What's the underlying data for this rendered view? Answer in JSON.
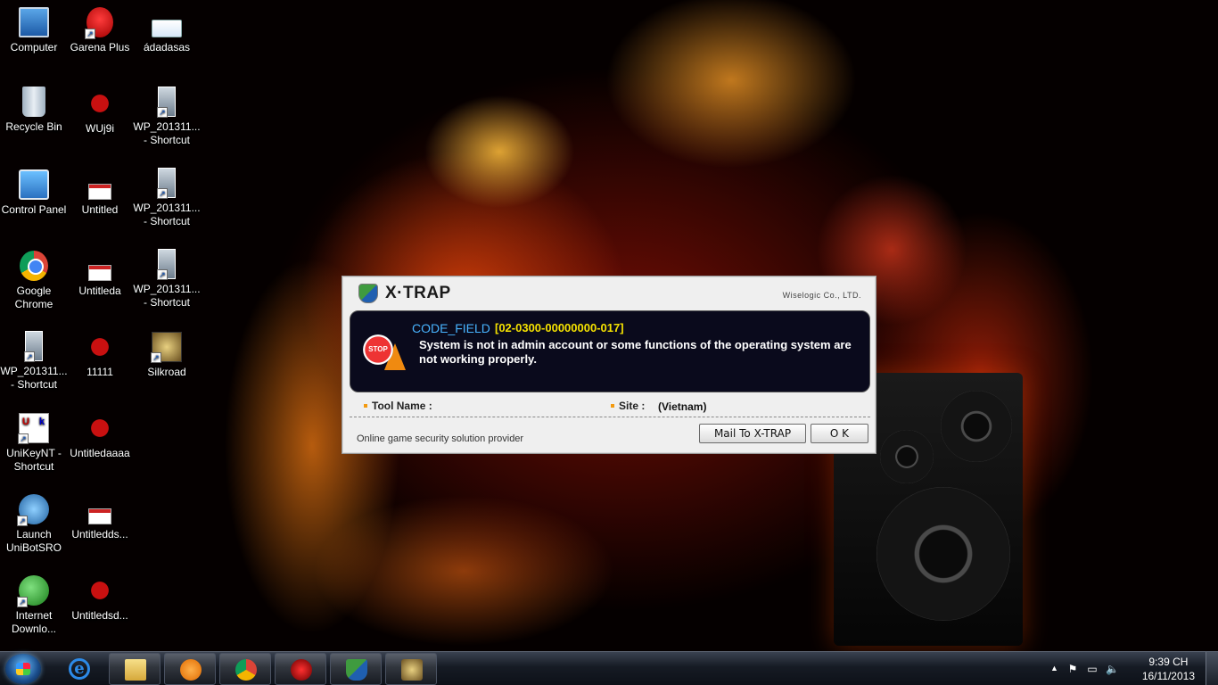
{
  "desktop": {
    "icons": [
      {
        "label": "Computer",
        "icon": "computer-icon"
      },
      {
        "label": "Garena Plus",
        "icon": "garena-icon"
      },
      {
        "label": "ádadasas",
        "icon": "document-icon"
      },
      {
        "label": "Recycle Bin",
        "icon": "recycle-bin-icon"
      },
      {
        "label": "WUj9i",
        "icon": "bug-icon"
      },
      {
        "label": "WP_201311... - Shortcut",
        "icon": "photo-icon"
      },
      {
        "label": "Control Panel",
        "icon": "control-panel-icon"
      },
      {
        "label": "Untitled",
        "icon": "paper-icon"
      },
      {
        "label": "WP_201311... - Shortcut",
        "icon": "photo-icon"
      },
      {
        "label": "Google Chrome",
        "icon": "chrome-icon"
      },
      {
        "label": "Untitleda",
        "icon": "paper-icon"
      },
      {
        "label": "WP_201311... - Shortcut",
        "icon": "photo-icon"
      },
      {
        "label": "WP_201311... - Shortcut",
        "icon": "photo-icon"
      },
      {
        "label": "11111",
        "icon": "bug-icon"
      },
      {
        "label": "Silkroad",
        "icon": "silkroad-icon"
      },
      {
        "label": "UniKeyNT - Shortcut",
        "icon": "unikey-icon"
      },
      {
        "label": "Untitledaaaa",
        "icon": "bug-icon"
      },
      {
        "label": "Launch UniBotSRO",
        "icon": "launch-icon"
      },
      {
        "label": "Untitledds...",
        "icon": "paper-icon"
      },
      {
        "label": "Internet Downlo...",
        "icon": "idm-icon"
      },
      {
        "label": "Untitledsd...",
        "icon": "bug-icon"
      }
    ]
  },
  "dialog": {
    "brand": "X·TRAP",
    "company": "Wiselogic Co., LTD.",
    "code_label": "CODE_FIELD",
    "code_value": "[02-0300-00000000-017]",
    "stop_text": "STOP",
    "message": "System is not in admin account or some functions of the operating system are not working properly.",
    "tool_name_label": "Tool Name :",
    "tool_name_value": "",
    "site_label": "Site :",
    "site_value": "(Vietnam)",
    "footer": "Online game security solution provider",
    "mail_button": "Mail To X-TRAP",
    "ok_button": "O K"
  },
  "taskbar": {
    "pinned": [
      {
        "name": "internet-explorer",
        "icon": "internet-explorer-icon",
        "glyph": "e"
      },
      {
        "name": "windows-explorer",
        "icon": "folder-icon",
        "glyph": ""
      },
      {
        "name": "windows-media-player",
        "icon": "media-player-icon",
        "glyph": ""
      },
      {
        "name": "google-chrome",
        "icon": "chrome-icon",
        "glyph": ""
      },
      {
        "name": "garena",
        "icon": "garena-icon",
        "glyph": ""
      },
      {
        "name": "xtrap",
        "icon": "xtrap-icon",
        "glyph": ""
      },
      {
        "name": "silkroad",
        "icon": "silkroad-icon",
        "glyph": ""
      }
    ],
    "tray": {
      "time": "9:39 CH",
      "date": "16/11/2013",
      "show_hidden": "▲"
    }
  }
}
